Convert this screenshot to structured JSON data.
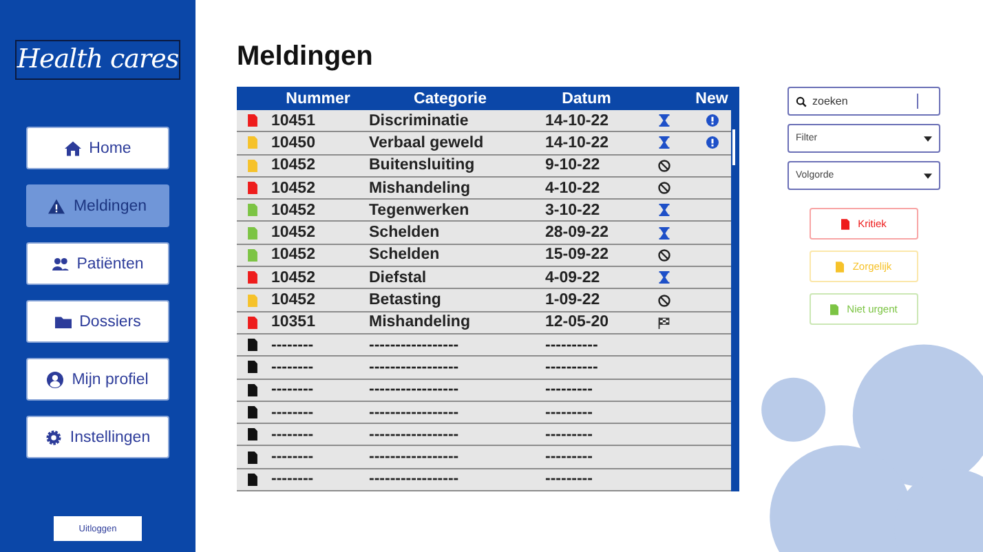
{
  "logo": "Health cares",
  "nav": [
    {
      "label": "Home",
      "kind": "home",
      "selected": false
    },
    {
      "label": "Meldingen",
      "kind": "warning",
      "selected": true
    },
    {
      "label": "Patiënten",
      "kind": "users",
      "selected": false
    },
    {
      "label": "Dossiers",
      "kind": "folder",
      "selected": false
    },
    {
      "label": "Mijn profiel",
      "kind": "user",
      "selected": false
    },
    {
      "label": "Instellingen",
      "kind": "gear",
      "selected": false
    }
  ],
  "logout": "Uitloggen",
  "title": "Meldingen",
  "table": {
    "columns": [
      "Nummer",
      "Categorie",
      "Datum",
      "",
      "New"
    ],
    "rows": [
      {
        "color": "#ee1c1c",
        "nummer": "10451",
        "categorie": "Discriminatie",
        "datum": "14-10-22",
        "kind": "pending",
        "new": true
      },
      {
        "color": "#f6c22a",
        "nummer": "10450",
        "categorie": "Verbaal geweld",
        "datum": "14-10-22",
        "kind": "pending",
        "new": true
      },
      {
        "color": "#f6c22a",
        "nummer": "10452",
        "categorie": "Buitensluiting",
        "datum": "9-10-22",
        "kind": "blocked",
        "new": false
      },
      {
        "color": "#ee1c1c",
        "nummer": "10452",
        "categorie": "Mishandeling",
        "datum": "4-10-22",
        "kind": "blocked",
        "new": false
      },
      {
        "color": "#7cc444",
        "nummer": "10452",
        "categorie": "Tegenwerken",
        "datum": "3-10-22",
        "kind": "pending",
        "new": false
      },
      {
        "color": "#7cc444",
        "nummer": "10452",
        "categorie": "Schelden",
        "datum": "28-09-22",
        "kind": "pending",
        "new": false
      },
      {
        "color": "#7cc444",
        "nummer": "10452",
        "categorie": "Schelden",
        "datum": "15-09-22",
        "kind": "blocked",
        "new": false
      },
      {
        "color": "#ee1c1c",
        "nummer": "10452",
        "categorie": "Diefstal",
        "datum": "4-09-22",
        "kind": "pending",
        "new": false
      },
      {
        "color": "#f6c22a",
        "nummer": "10452",
        "categorie": "Betasting",
        "datum": "1-09-22",
        "kind": "blocked",
        "new": false
      },
      {
        "color": "#ee1c1c",
        "nummer": "10351",
        "categorie": "Mishandeling",
        "datum": "12-05-20",
        "kind": "finished",
        "new": false
      },
      {
        "color": "#111111",
        "nummer": "--------",
        "categorie": "-----------------",
        "datum": "----------",
        "new": false
      },
      {
        "color": "#111111",
        "nummer": "--------",
        "categorie": "-----------------",
        "datum": "----------",
        "new": false
      },
      {
        "color": "#111111",
        "nummer": "--------",
        "categorie": "-----------------",
        "datum": "---------",
        "new": false
      },
      {
        "color": "#111111",
        "nummer": "--------",
        "categorie": "-----------------",
        "datum": "---------",
        "new": false
      },
      {
        "color": "#111111",
        "nummer": "--------",
        "categorie": "-----------------",
        "datum": "---------",
        "new": false
      },
      {
        "color": "#111111",
        "nummer": "--------",
        "categorie": "-----------------",
        "datum": "---------",
        "new": false
      },
      {
        "color": "#111111",
        "nummer": "--------",
        "categorie": "-----------------",
        "datum": "---------",
        "new": false
      }
    ]
  },
  "search": {
    "value": "zoeken"
  },
  "filter": {
    "placeholder": "Filter"
  },
  "order": {
    "placeholder": "Volgorde"
  },
  "legend": [
    {
      "label": "Kritiek",
      "color": "#ee1c1c"
    },
    {
      "label": "Zorgelijk",
      "color": "#f6c22a"
    },
    {
      "label": "Niet urgent",
      "color": "#7cc444"
    }
  ]
}
